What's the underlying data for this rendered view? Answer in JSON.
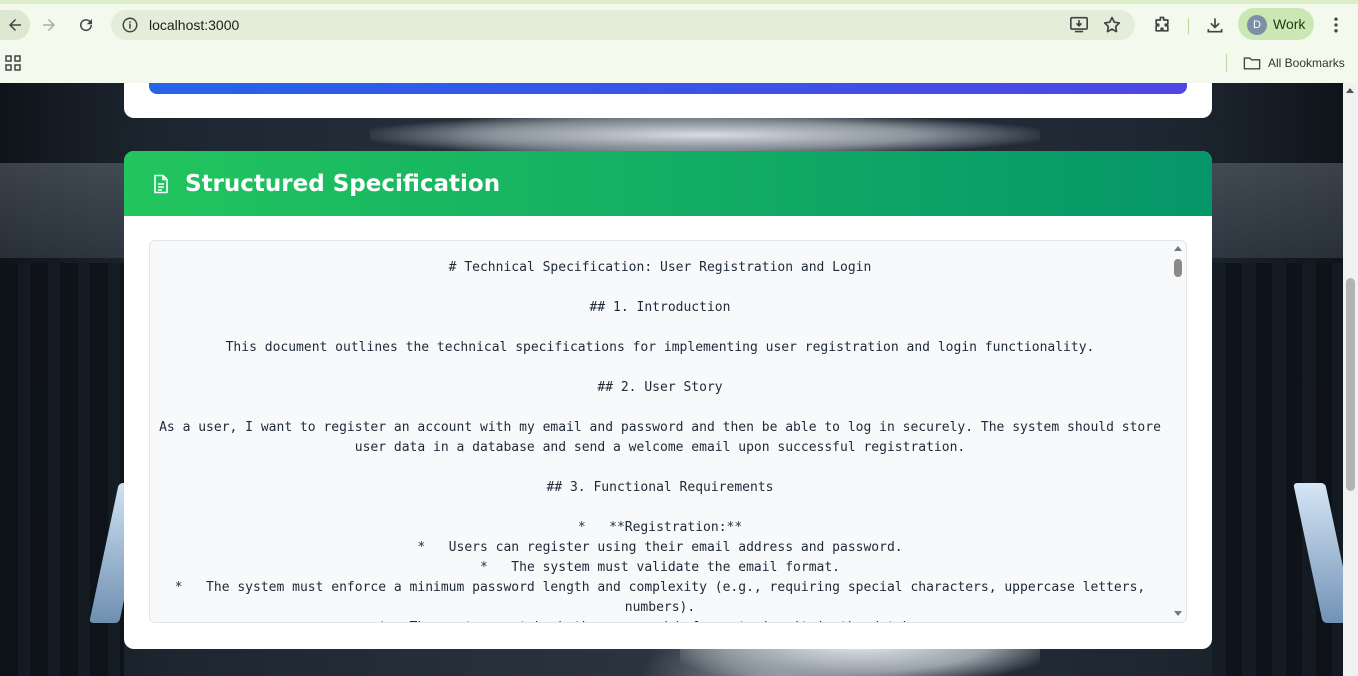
{
  "browser": {
    "url": "localhost:3000",
    "profile_initial": "D",
    "profile_label": "Work",
    "all_bookmarks_label": "All Bookmarks"
  },
  "spec": {
    "title": "Structured Specification",
    "lines": [
      "# Technical Specification: User Registration and Login",
      "",
      "## 1. Introduction",
      "",
      "This document outlines the technical specifications for implementing user registration and login functionality.",
      "",
      "## 2. User Story",
      "",
      "As a user, I want to register an account with my email and password and then be able to log in securely. The system should store user data in a database and send a welcome email upon successful registration.",
      "",
      "## 3. Functional Requirements",
      "",
      "*   **Registration:**",
      "*   Users can register using their email address and password.",
      "*   The system must validate the email format.",
      "*   The system must enforce a minimum password length and complexity (e.g., requiring special characters, uppercase letters, numbers).",
      "*   The system must hash the password before storing it in the database."
    ]
  },
  "colors": {
    "header_gradient_start": "#22c55e",
    "header_gradient_end": "#059669",
    "progress_gradient_start": "#2563eb",
    "progress_gradient_end": "#4f46e5"
  }
}
